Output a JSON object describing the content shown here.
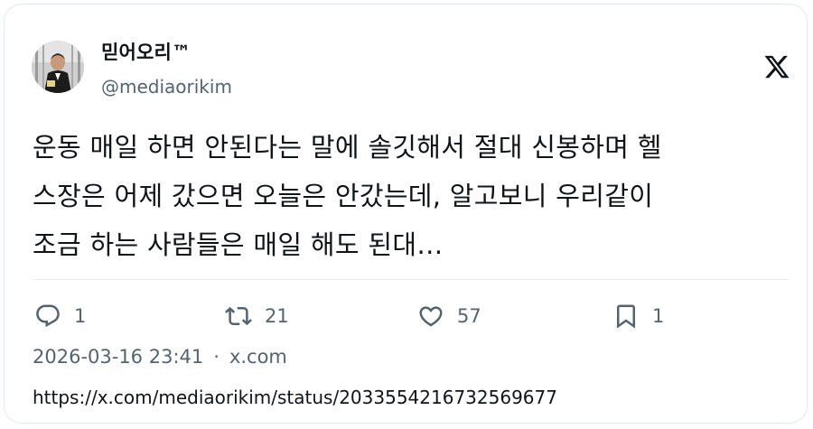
{
  "author": {
    "name": "믿어오리™",
    "handle": "@mediaorikim"
  },
  "tweet": {
    "line1": "운동 매일 하면 안된다는 말에 솔깃해서 절대 신봉하며 헬",
    "line2": "스장은 어제 갔으면 오늘은 안갔는데, 알고보니 우리같이",
    "line3": "조금 하는 사람들은 매일 해도 된대…"
  },
  "actions": {
    "reply": {
      "icon": "reply-icon",
      "count": "1"
    },
    "retweet": {
      "icon": "retweet-icon",
      "count": "21"
    },
    "like": {
      "icon": "heart-icon",
      "count": "57"
    },
    "bookmark": {
      "icon": "bookmark-icon",
      "count": "1"
    }
  },
  "meta": {
    "timestamp": "2026-03-16 23:41",
    "separator": "·",
    "source": "x.com"
  },
  "url": "https://x.com/mediaorikim/status/2033554216732569677",
  "colors": {
    "text": "#0f1419",
    "secondary": "#536471",
    "border": "#e1e8ed"
  }
}
